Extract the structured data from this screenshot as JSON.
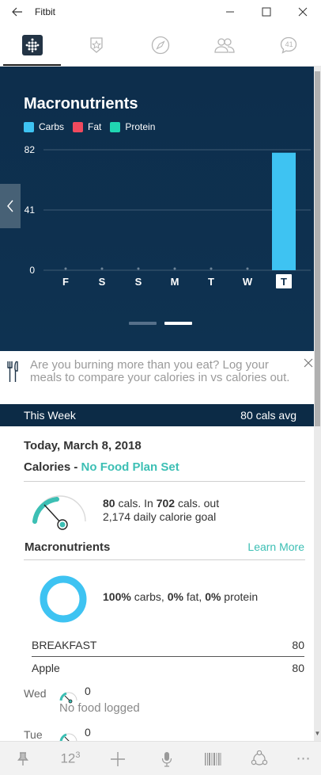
{
  "window": {
    "title": "Fitbit"
  },
  "tabs": [
    {
      "name": "dashboard",
      "icon": "dashboard-dots-icon",
      "active": true
    },
    {
      "name": "challenges",
      "icon": "star-badge-icon",
      "active": false
    },
    {
      "name": "discover",
      "icon": "compass-icon",
      "active": false
    },
    {
      "name": "friends",
      "icon": "friends-icon",
      "active": false
    },
    {
      "name": "messages",
      "icon": "chat-bubble-icon",
      "badge": "41",
      "active": false
    }
  ],
  "chart": {
    "title": "Macronutrients",
    "legend": [
      {
        "label": "Carbs",
        "color": "#3ec3f2"
      },
      {
        "label": "Fat",
        "color": "#f04a5e"
      },
      {
        "label": "Protein",
        "color": "#20d6b2"
      }
    ]
  },
  "chart_data": {
    "type": "bar",
    "title": "Macronutrients",
    "categories": [
      "F",
      "S",
      "S",
      "M",
      "T",
      "W",
      "T"
    ],
    "highlighted_category_index": 6,
    "series": [
      {
        "name": "Carbs",
        "color": "#3ec3f2",
        "values": [
          0,
          0,
          0,
          0,
          0,
          0,
          80
        ]
      },
      {
        "name": "Fat",
        "color": "#f04a5e",
        "values": [
          0,
          0,
          0,
          0,
          0,
          0,
          0
        ]
      },
      {
        "name": "Protein",
        "color": "#20d6b2",
        "values": [
          0,
          0,
          0,
          0,
          0,
          0,
          0
        ]
      }
    ],
    "yticks": [
      "82",
      "41",
      "0"
    ],
    "ylim": [
      0,
      82
    ],
    "grid": true,
    "legend_position": "top-left"
  },
  "pager": {
    "count": 2,
    "active_index": 1
  },
  "banner": {
    "text": "Are you burning more than you eat? Log your meals to compare your calories in vs calories out."
  },
  "week_bar": {
    "label": "This Week",
    "avg": "80 cals avg"
  },
  "summary": {
    "date": "Today, March 8, 2018",
    "calories_label": "Calories - ",
    "plan_status": "No Food Plan Set",
    "cals_in_value": "80",
    "cals_in_text": " cals. In  ",
    "cals_out_value": "702",
    "cals_out_text": " cals. out",
    "goal_text": "2,174 daily calorie goal",
    "gauge_fraction": 0.04
  },
  "macros": {
    "title": "Macronutrients",
    "learn_more": "Learn More",
    "carbs_pct": "100%",
    "carbs_label": " carbs, ",
    "fat_pct": "0%",
    "fat_label": " fat, ",
    "protein_pct": "0%",
    "protein_label": " protein",
    "donut_color": "#3ec3f2"
  },
  "meals": [
    {
      "label": "BREAKFAST",
      "value": "80"
    },
    {
      "label": "Apple",
      "value": "80"
    }
  ],
  "days": [
    {
      "day": "Wed",
      "value": "0",
      "note": "No food logged"
    },
    {
      "day": "Tue",
      "value": "0"
    }
  ],
  "app_bar": [
    {
      "name": "pin",
      "icon": "pin-icon"
    },
    {
      "name": "number-entry",
      "icon": "number-123-icon",
      "label": "123"
    },
    {
      "name": "add",
      "icon": "plus-icon"
    },
    {
      "name": "voice",
      "icon": "microphone-icon"
    },
    {
      "name": "barcode",
      "icon": "barcode-icon"
    },
    {
      "name": "share",
      "icon": "share-nodes-icon"
    },
    {
      "name": "more",
      "icon": "more-dots-icon",
      "label": "..."
    }
  ]
}
